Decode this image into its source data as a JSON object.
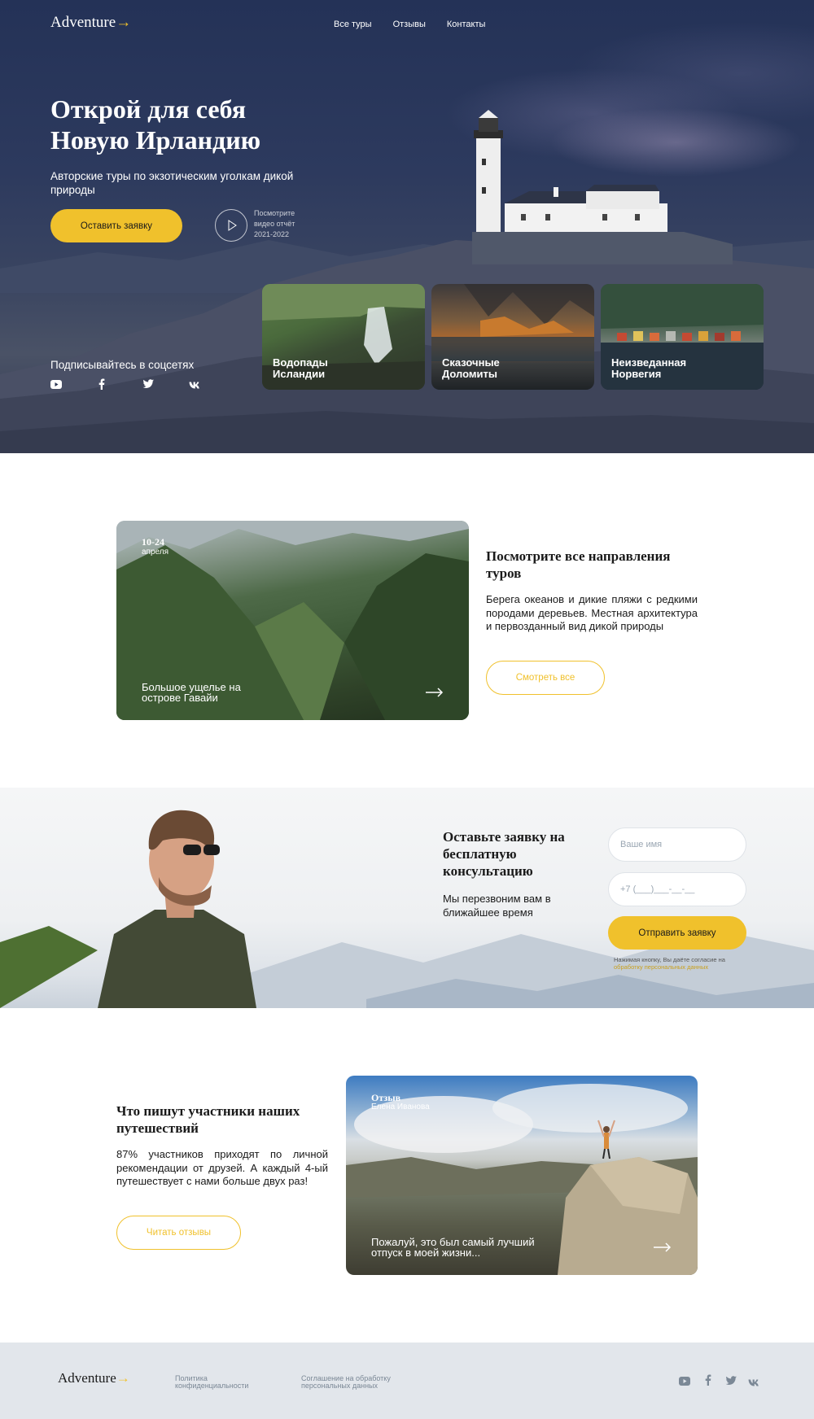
{
  "header": {
    "logo": "Adventure",
    "logo_arrow": "→",
    "nav": [
      "Все туры",
      "Отзывы",
      "Контакты"
    ]
  },
  "hero": {
    "title_line1": "Открой для себя",
    "title_line2": "Новую Ирландию",
    "subtitle": "Авторские туры по экзотическим уголкам дикой природы",
    "cta": "Оставить заявку",
    "video_text": "Посмотрите видео отчёт 2021-2022",
    "social_title": "Подписывайтесь в соцсетях",
    "social_icons": [
      "youtube-icon",
      "facebook-icon",
      "twitter-icon",
      "vk-icon"
    ],
    "tours": [
      {
        "line1": "Водопады",
        "line2": "Исландии"
      },
      {
        "line1": "Сказочные",
        "line2": "Доломиты"
      },
      {
        "line1": "Неизведанная",
        "line2": "Норвегия"
      }
    ]
  },
  "directions": {
    "card_date": "10-24",
    "card_month": "апреля",
    "card_caption": "Большое ущелье на острове Гавайи",
    "title": "Посмотрите все направления туров",
    "text": "Берега океанов и дикие пляжи с редкими породами деревьев. Местная архитектура и первозданный вид дикой природы",
    "button": "Смотреть все"
  },
  "consult": {
    "title": "Оставьте заявку на бесплатную консультацию",
    "text": "Мы перезвоним вам в ближайшее время",
    "name_placeholder": "Ваше имя",
    "phone_placeholder": "+7 (___)___-__-__",
    "submit": "Отправить заявку",
    "consent_text": "Нажимая кнопку, Вы даёте согласие на",
    "consent_link": "обработку персональных данных"
  },
  "reviews": {
    "title": "Что пишут участники наших путешествий",
    "text": "87% участников приходят по личной рекомендации от друзей. А каждый 4-ый путешествует с нами больше двух раз!",
    "button": "Читать отзывы",
    "card_label": "Отзыв",
    "card_name": "Елена Иванова",
    "card_quote": "Пожалуй, это был самый лучший отпуск в моей жизни..."
  },
  "footer": {
    "logo": "Adventure",
    "logo_arrow": "→",
    "privacy": "Политика конфиденциальности",
    "agreement": "Соглашение на обработку персональных данных",
    "social_icons": [
      "youtube-icon",
      "facebook-icon",
      "twitter-icon",
      "vk-icon"
    ]
  },
  "colors": {
    "accent": "#f0c12c",
    "hero_bg": "#243257",
    "footer_bg": "#e2e6eb"
  }
}
